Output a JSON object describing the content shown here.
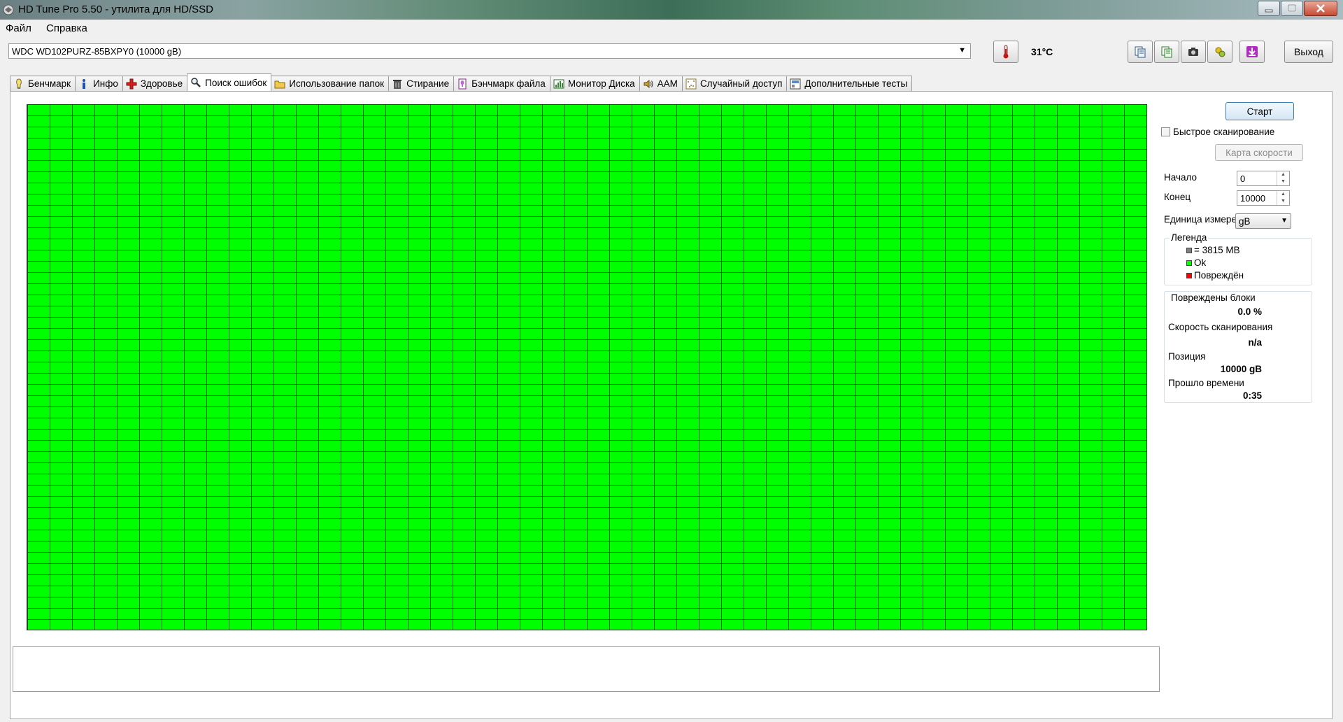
{
  "window": {
    "title": "HD Tune Pro 5.50 - утилита для HD/SSD"
  },
  "menu": {
    "file": "Файл",
    "help": "Справка"
  },
  "toolbar": {
    "drive": "WDC WD102PURZ-85BXPY0 (10000 gB)",
    "temperature": "31°C",
    "exit_label": "Выход"
  },
  "tabs": [
    {
      "label": "Бенчмарк",
      "icon": "gauge-icon"
    },
    {
      "label": "Инфо",
      "icon": "info-icon"
    },
    {
      "label": "Здоровье",
      "icon": "health-cross-icon"
    },
    {
      "label": "Поиск ошибок",
      "icon": "magnifier-icon",
      "active": true
    },
    {
      "label": "Использование папок",
      "icon": "folder-icon"
    },
    {
      "label": "Стирание",
      "icon": "trash-icon"
    },
    {
      "label": "Бэнчмарк файла",
      "icon": "file-benchmark-icon"
    },
    {
      "label": "Монитор Диска",
      "icon": "disk-monitor-icon"
    },
    {
      "label": "AAM",
      "icon": "speaker-icon"
    },
    {
      "label": "Случайный доступ",
      "icon": "random-access-icon"
    },
    {
      "label": "Дополнительные  тесты",
      "icon": "extra-tests-icon"
    }
  ],
  "scan": {
    "start_label": "Старт",
    "quick_scan_label": "Быстрое сканирование",
    "quick_scan_checked": false,
    "speed_map_label": "Карта скорости",
    "start_field_label": "Начало",
    "start_value": "0",
    "end_field_label": "Конец",
    "end_value": "10000",
    "unit_label": "Единица измерения",
    "unit_value": "gB"
  },
  "legend": {
    "title": "Легенда",
    "block_size": "= 3815 MB",
    "ok": "Ok",
    "damaged": "Повреждён",
    "ok_color": "#00ff00",
    "damaged_color": "#ff0000",
    "block_color": "#808080"
  },
  "stats": {
    "damaged_blocks_label": "Повреждены блоки",
    "damaged_blocks_value": "0.0 %",
    "scan_speed_label": "Скорость сканирования",
    "scan_speed_value": "n/a",
    "position_label": "Позиция",
    "position_value": "10000 gB",
    "elapsed_label": "Прошло времени",
    "elapsed_value": "0:35"
  },
  "grid": {
    "ok_color": "#00ff00",
    "damaged_blocks": 0
  }
}
